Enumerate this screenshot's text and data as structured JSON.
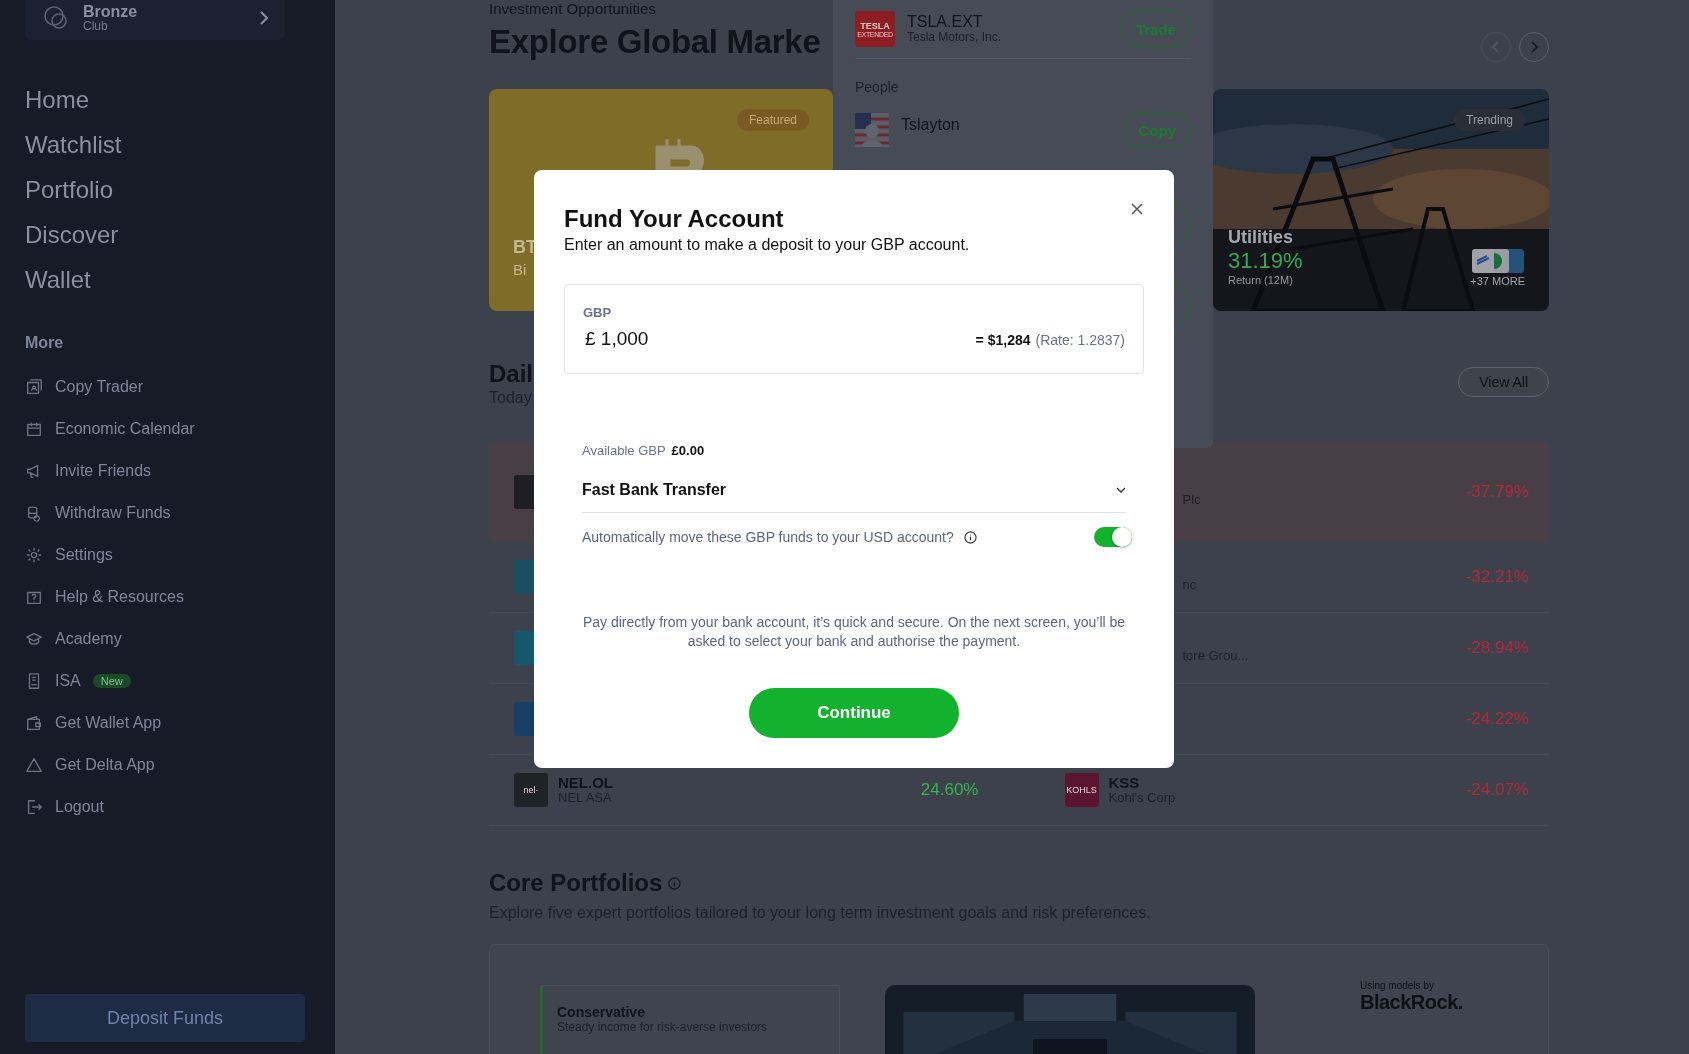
{
  "sidebar": {
    "club": {
      "name": "Bronze",
      "sub": "Club"
    },
    "nav": [
      {
        "label": "Home"
      },
      {
        "label": "Watchlist"
      },
      {
        "label": "Portfolio"
      },
      {
        "label": "Discover"
      },
      {
        "label": "Wallet"
      }
    ],
    "more_heading": "More",
    "more_items": [
      {
        "label": "Copy Trader",
        "kind": "copy"
      },
      {
        "label": "Economic Calendar",
        "kind": "calendar"
      },
      {
        "label": "Invite Friends",
        "kind": "megaphone"
      },
      {
        "label": "Withdraw Funds",
        "kind": "coins"
      },
      {
        "label": "Settings",
        "kind": "gear"
      },
      {
        "label": "Help & Resources",
        "kind": "help"
      },
      {
        "label": "Academy",
        "kind": "cap"
      },
      {
        "label": "ISA",
        "kind": "isa",
        "badge": "New"
      },
      {
        "label": "Get Wallet App",
        "kind": "wallet"
      },
      {
        "label": "Get Delta App",
        "kind": "triangle"
      },
      {
        "label": "Logout",
        "kind": "logout"
      }
    ],
    "deposit_button": "Deposit Funds"
  },
  "opportunities": {
    "eyebrow": "Investment Opportunities",
    "title": "Explore Global Marke",
    "arrows": [
      {
        "disabled": true
      },
      {
        "disabled": false
      }
    ],
    "cards": [
      {
        "kind": "crypto",
        "badge": "Featured",
        "title": "BT",
        "subtitle": "Bi"
      },
      {
        "kind": "sector",
        "badge": "Trending",
        "title": "Utilities",
        "return": "31.19%",
        "return_label": "Return (12M)",
        "more": "+37 MORE"
      }
    ]
  },
  "search_results": {
    "instrument": {
      "symbol": "TSLA.EXT",
      "name": "Tesla Motors, Inc.",
      "logo_text": "TESLA",
      "logo_subtext": "EXTENDED",
      "action": "Trade"
    },
    "people_heading": "People",
    "people": [
      {
        "name": "Tslayton",
        "action": "Copy"
      }
    ]
  },
  "movers": {
    "title": "Dail",
    "subtitle": "Today",
    "view_all": "View All",
    "rows": [
      {
        "selected": true,
        "left": {
          "color": "#1d1f24"
        },
        "right": {
          "name": "Plc",
          "change": "-37.79%"
        }
      },
      {
        "selected": false,
        "left": {
          "color": "#1a4f62"
        },
        "right": {
          "name": "nc",
          "change": "-32.21%"
        }
      },
      {
        "selected": false,
        "left": {
          "color": "#15586b"
        },
        "right": {
          "name": "tore Grou...",
          "change": "-28.94%"
        }
      },
      {
        "selected": false,
        "left": {
          "color": "#1a3f66"
        },
        "right": {
          "change": "-24.22%"
        }
      },
      {
        "selected": false,
        "left": {
          "color": "#1f2227",
          "logo_text": "nel·",
          "symbol": "NEL.OL",
          "name": "NEL ASA",
          "change": "24.60%"
        },
        "right": {
          "color": "#5a1530",
          "logo_text": "KOHLS",
          "symbol": "KSS",
          "name": "Kohl's Corp",
          "change": "-24.07%"
        }
      }
    ]
  },
  "core": {
    "title": "Core Portfolios",
    "description": "Explore five expert portfolios tailored to your long term investment goals and risk preferences.",
    "portfolio": {
      "name": "Conservative",
      "description": "Steady income for risk-averse investors"
    },
    "credit_label": "Using models by",
    "credit_brand": "BlackRock."
  },
  "modal": {
    "title": "Fund Your Account",
    "subtitle": "Enter an amount to make a deposit to your GBP account.",
    "amount": {
      "label": "GBP",
      "value": "£ 1,000",
      "converted": "= $1,284",
      "rate": "(Rate: 1.2837)"
    },
    "available_label": "Available GBP",
    "available_value": "£0.00",
    "method": "Fast Bank Transfer",
    "auto_move": {
      "label": "Automatically move these GBP funds to your USD account?",
      "on": true
    },
    "note": "Pay directly from your bank account, it’s quick and secure. On the next screen, you’ll be asked to select your bank and authorise the payment.",
    "continue": "Continue"
  }
}
